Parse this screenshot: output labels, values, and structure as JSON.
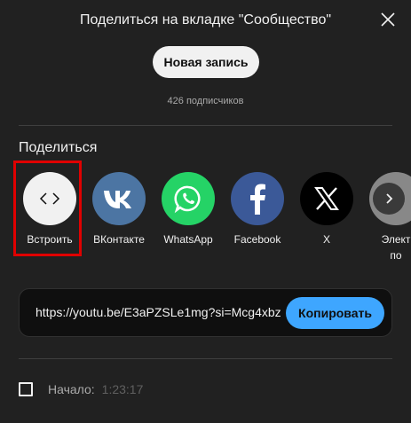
{
  "dialog": {
    "title": "Поделиться на вкладке \"Сообщество\"",
    "new_post_label": "Новая запись",
    "subscribers": "426 подписчиков"
  },
  "share": {
    "heading": "Поделиться",
    "items": [
      {
        "label": "Встроить",
        "icon": "embed-code-icon",
        "color": "#f1f1f1"
      },
      {
        "label": "ВКонтакте",
        "icon": "vk-icon",
        "color": "#4c75a3"
      },
      {
        "label": "WhatsApp",
        "icon": "whatsapp-icon",
        "color": "#25d366"
      },
      {
        "label": "Facebook",
        "icon": "facebook-icon",
        "color": "#3b5998"
      },
      {
        "label": "X",
        "icon": "x-icon",
        "color": "#000000"
      },
      {
        "label": "Элект",
        "label_line2": "по",
        "icon": "email-icon",
        "color": "#888888"
      }
    ],
    "highlight_color": "#e00000"
  },
  "link": {
    "url": "https://youtu.be/E3aPZSLe1mg?si=Mcg4xbz",
    "copy_label": "Копировать",
    "accent": "#3ea6ff"
  },
  "start": {
    "label": "Начало:",
    "time": "1:23:17",
    "checked": false
  }
}
